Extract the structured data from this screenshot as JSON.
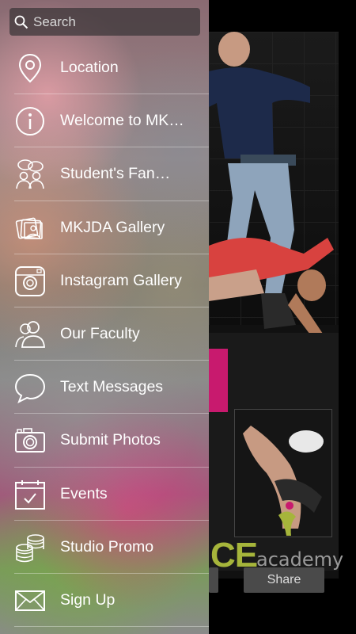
{
  "search": {
    "placeholder": "Search"
  },
  "menu": [
    {
      "label": "Location",
      "icon": "location-pin-icon"
    },
    {
      "label": "Welcome to MK…",
      "icon": "info-icon"
    },
    {
      "label": "Student's Fan…",
      "icon": "people-chat-icon"
    },
    {
      "label": "MKJDA Gallery",
      "icon": "gallery-icon"
    },
    {
      "label": "Instagram Gallery",
      "icon": "instagram-icon"
    },
    {
      "label": "Our Faculty",
      "icon": "users-icon"
    },
    {
      "label": "Text Messages",
      "icon": "speech-bubble-icon"
    },
    {
      "label": "Submit Photos",
      "icon": "camera-icon"
    },
    {
      "label": "Events",
      "icon": "calendar-icon"
    },
    {
      "label": "Studio Promo",
      "icon": "coins-icon"
    },
    {
      "label": "Sign Up",
      "icon": "envelope-icon"
    }
  ],
  "background": {
    "brand_big": "CE",
    "brand_small": "academy",
    "share_label": "Share"
  },
  "colors": {
    "accent_pink": "#c81a6e",
    "brand_green": "#a6b53b"
  }
}
